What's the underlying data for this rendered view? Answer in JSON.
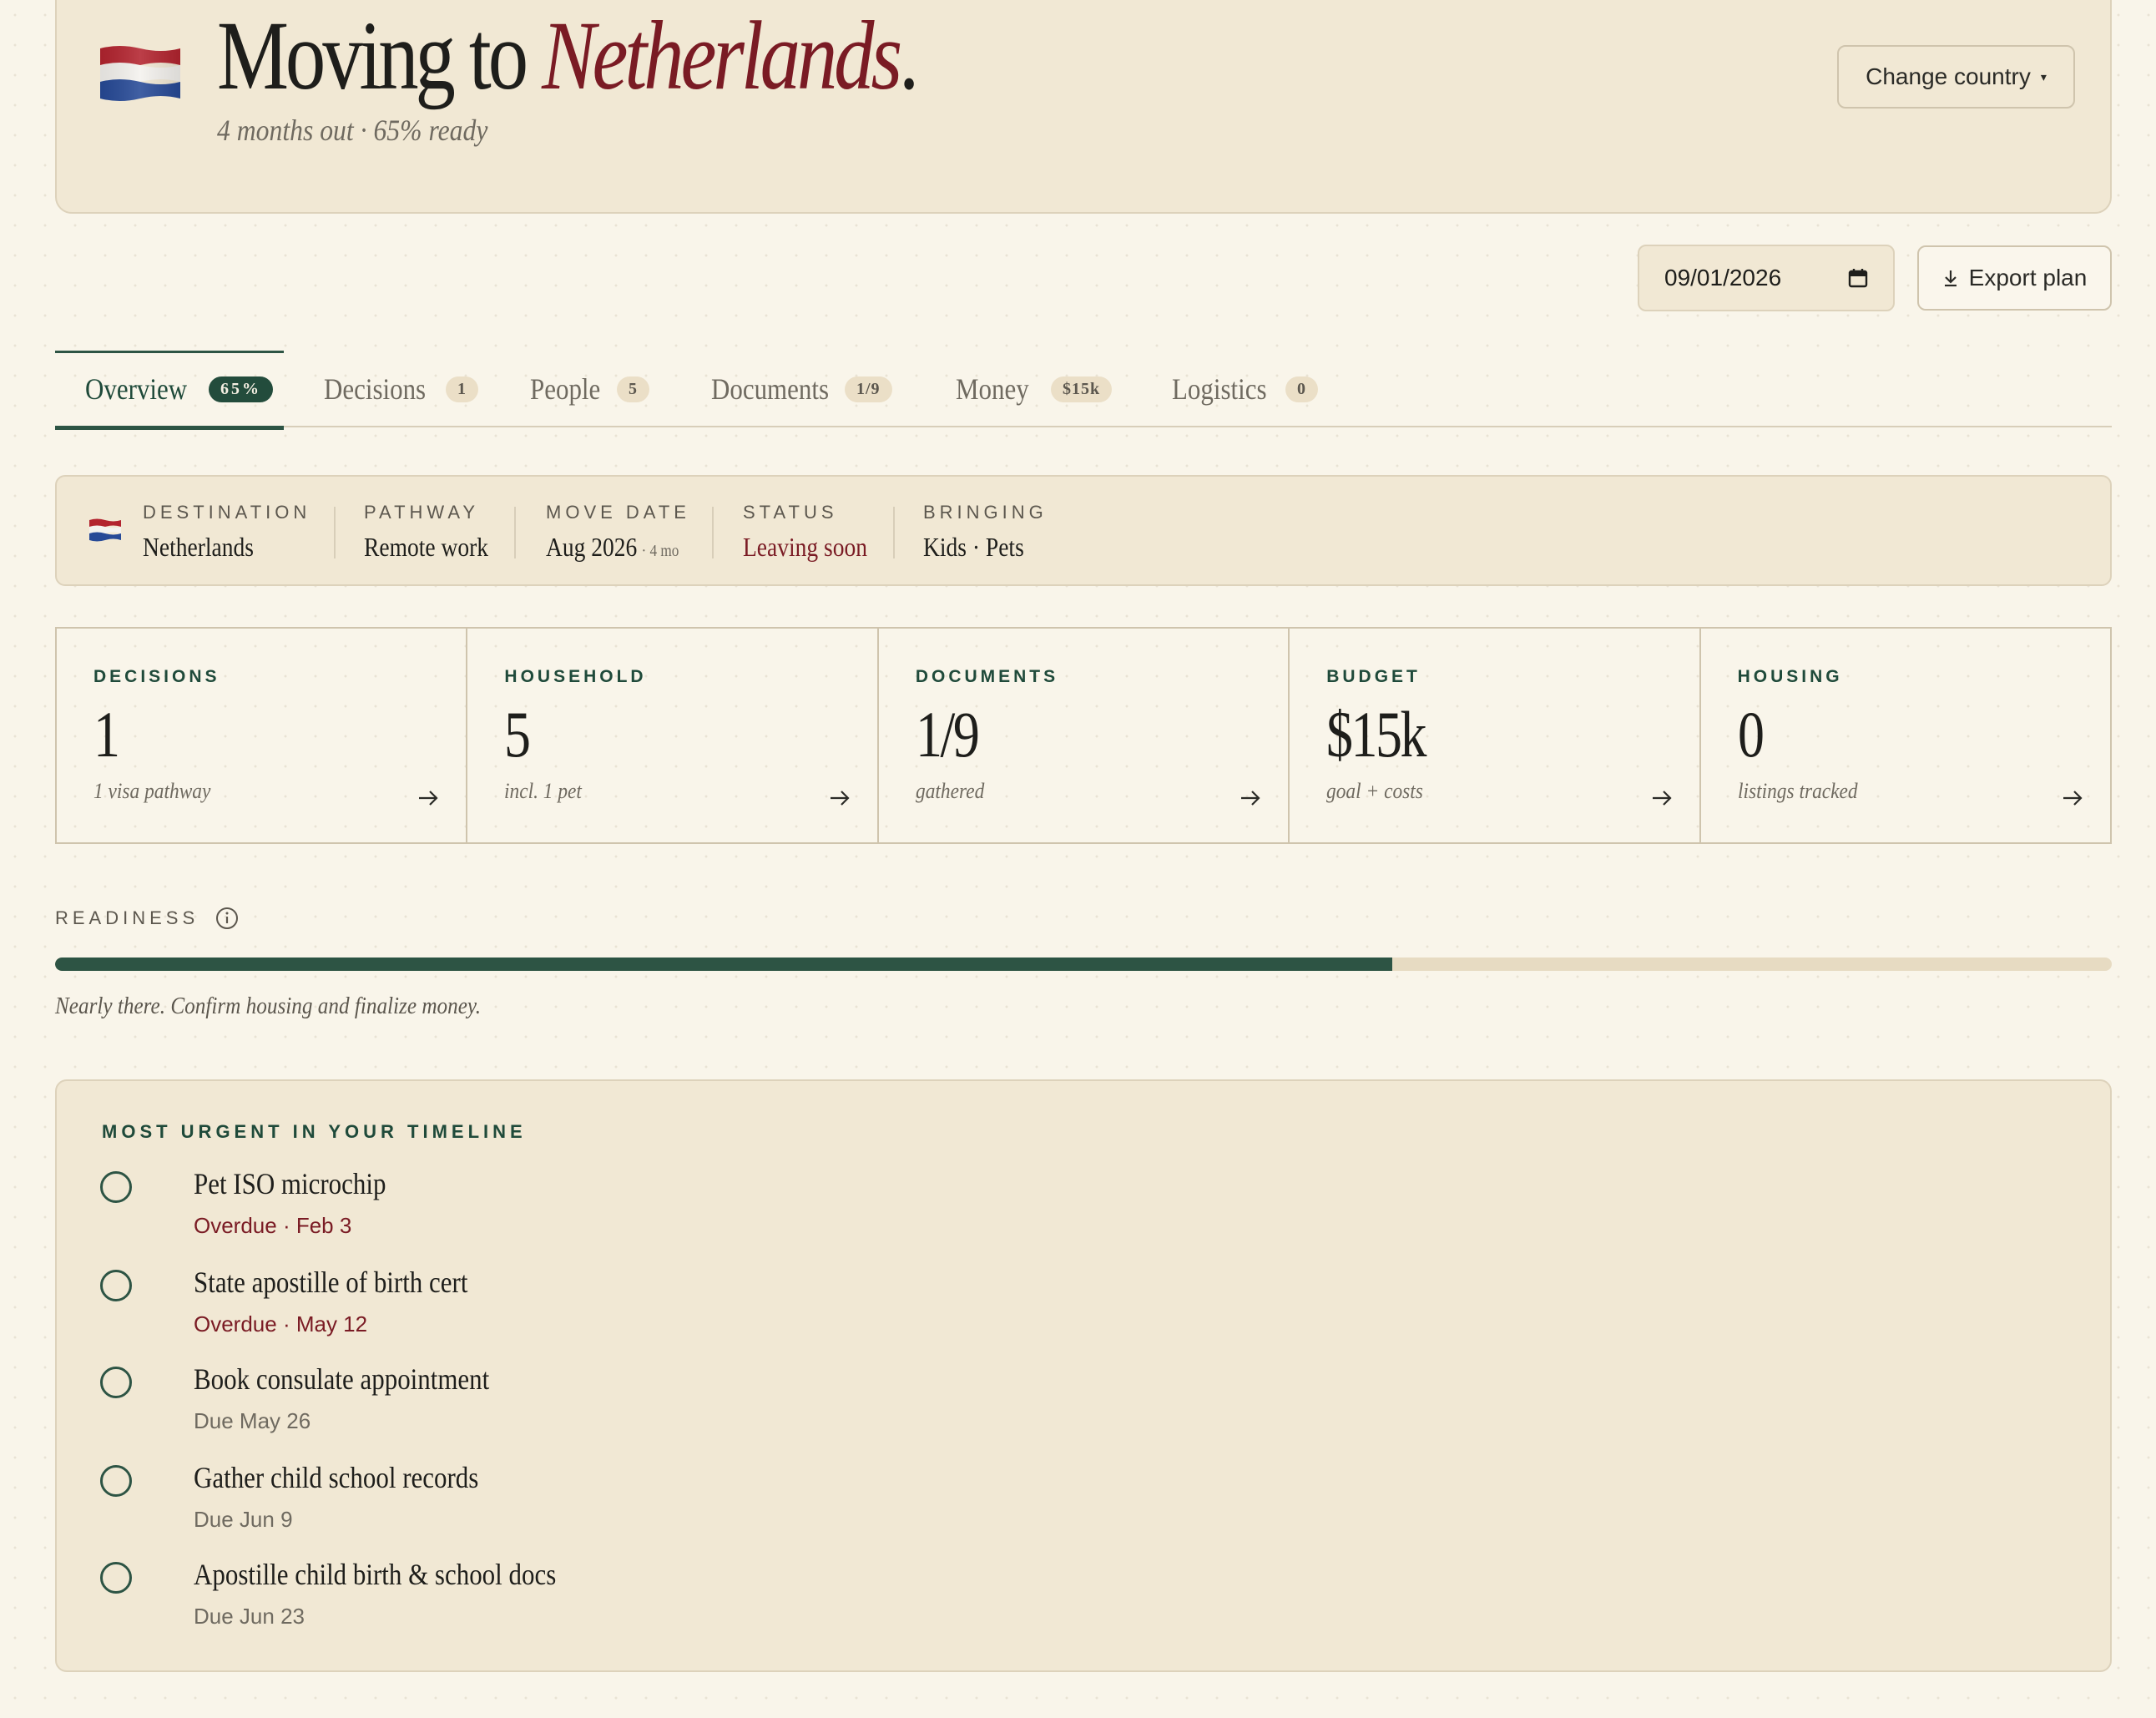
{
  "hero": {
    "flag_icon": "netherlands-flag-icon",
    "title_prefix": "Moving to ",
    "title_country": "Netherlands",
    "title_period": ".",
    "subtitle": "4 months out · 65% ready",
    "change_country_label": "Change country",
    "change_country_caret": "▾"
  },
  "toolbar": {
    "date_value": "09/01/2026",
    "export_label": "Export plan"
  },
  "tabs": [
    {
      "label": "Overview",
      "badge": "65%",
      "active": true
    },
    {
      "label": "Decisions",
      "badge": "1"
    },
    {
      "label": "People",
      "badge": "5"
    },
    {
      "label": "Documents",
      "badge": "1/9"
    },
    {
      "label": "Money",
      "badge": "$15k"
    },
    {
      "label": "Logistics",
      "badge": "0"
    }
  ],
  "summary": {
    "destination_label": "DESTINATION",
    "destination": "Netherlands",
    "pathway_label": "PATHWAY",
    "pathway": "Remote work",
    "move_date_label": "MOVE DATE",
    "move_date": "Aug 2026",
    "move_date_rel": "· 4 mo",
    "status_label": "STATUS",
    "status": "Leaving soon",
    "bringing_label": "BRINGING",
    "bringing": "Kids · Pets"
  },
  "stats": [
    {
      "label": "DECISIONS",
      "value": "1",
      "sub": "1 visa pathway"
    },
    {
      "label": "HOUSEHOLD",
      "value": "5",
      "sub": "incl. 1 pet"
    },
    {
      "label": "DOCUMENTS",
      "value": "1/9",
      "sub": "gathered"
    },
    {
      "label": "BUDGET",
      "value": "$15k",
      "sub": "goal + costs"
    },
    {
      "label": "HOUSING",
      "value": "0",
      "sub": "listings tracked"
    }
  ],
  "readiness": {
    "label": "READINESS",
    "percent": 65,
    "note": "Nearly there. Confirm housing and finalize money."
  },
  "urgent": {
    "title": "MOST URGENT IN YOUR TIMELINE",
    "tasks": [
      {
        "name": "Pet ISO microchip",
        "due": "Overdue · Feb 3",
        "overdue": true
      },
      {
        "name": "State apostille of birth cert",
        "due": "Overdue · May 12",
        "overdue": true
      },
      {
        "name": "Book consulate appointment",
        "due": "Due May 26",
        "overdue": false
      },
      {
        "name": "Gather child school records",
        "due": "Due Jun 9",
        "overdue": false
      },
      {
        "name": "Apostille child birth & school docs",
        "due": "Due Jun 23",
        "overdue": false
      }
    ]
  },
  "colors": {
    "accent_green": "#2d5444",
    "accent_red": "#7a1b24",
    "background": "#f9f5ea",
    "card": "#f1e8d4"
  }
}
